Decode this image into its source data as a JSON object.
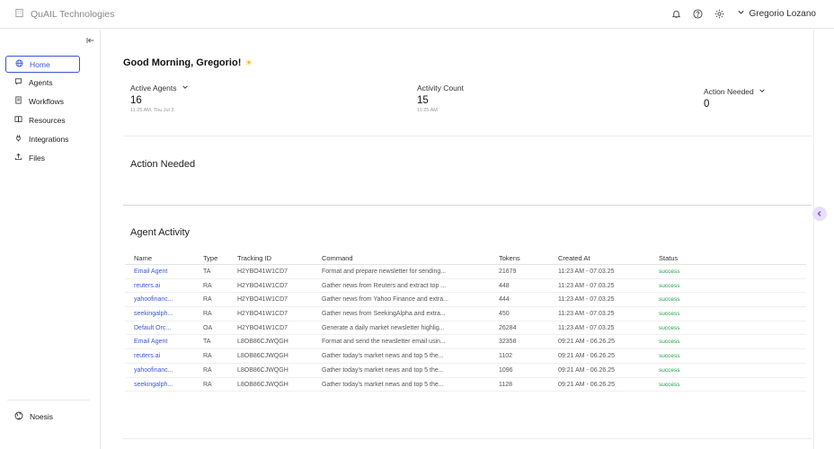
{
  "app": {
    "brand": "QuAIL Technologies"
  },
  "header": {
    "user_name": "Gregorio Lozano"
  },
  "sidebar": {
    "items": [
      {
        "label": "Home",
        "icon": "globe-icon",
        "active": true
      },
      {
        "label": "Agents",
        "icon": "chat-icon"
      },
      {
        "label": "Workflows",
        "icon": "document-icon"
      },
      {
        "label": "Resources",
        "icon": "book-icon"
      },
      {
        "label": "Integrations",
        "icon": "plug-icon"
      },
      {
        "label": "Files",
        "icon": "upload-icon"
      }
    ],
    "footer_label": "Noesis"
  },
  "main": {
    "greeting": "Good Morning, Gregorio!",
    "stats": [
      {
        "label": "Active Agents",
        "value": "16",
        "sub": "11:25 AM, Thu Jul 3"
      },
      {
        "label": "Activity Count",
        "value": "15",
        "sub": "11:25 AM"
      },
      {
        "label": "Action Needed",
        "value": "0",
        "sub": ""
      }
    ],
    "action_needed_title": "Action Needed",
    "activity_title": "Agent Activity"
  },
  "table": {
    "columns": [
      "Name",
      "Type",
      "Tracking ID",
      "Command",
      "Tokens",
      "Created At",
      "Status"
    ],
    "rows": [
      {
        "name": "Email Agent",
        "type": "TA",
        "tracking_id": "H2YBO41W1CD7",
        "command": "Format and prepare newsletter for sending...",
        "tokens": "21679",
        "created": "11:23 AM - 07.03.25",
        "status": "success"
      },
      {
        "name": "reuters.ai",
        "type": "RA",
        "tracking_id": "H2YBO41W1CD7",
        "command": "Gather news from Reuters and extract top ...",
        "tokens": "448",
        "created": "11:23 AM - 07.03.25",
        "status": "success"
      },
      {
        "name": "yahoofinanc...",
        "type": "RA",
        "tracking_id": "H2YBO41W1CD7",
        "command": "Gather news from Yahoo Finance and extra...",
        "tokens": "444",
        "created": "11:23 AM - 07.03.25",
        "status": "success"
      },
      {
        "name": "seekingalph...",
        "type": "RA",
        "tracking_id": "H2YBO41W1CD7",
        "command": "Gather news from SeekingAlpha and extra...",
        "tokens": "450",
        "created": "11:23 AM - 07.03.25",
        "status": "success"
      },
      {
        "name": "Default Orc...",
        "type": "OA",
        "tracking_id": "H2YBO41W1CD7",
        "command": "Generate a daily market newsletter highlig...",
        "tokens": "26284",
        "created": "11:23 AM - 07.03.25",
        "status": "success"
      },
      {
        "name": "Email Agent",
        "type": "TA",
        "tracking_id": "L8OB86CJWQGH",
        "command": "Format and send the newsletter email usin...",
        "tokens": "32358",
        "created": "09:21 AM - 06.26.25",
        "status": "success"
      },
      {
        "name": "reuters.ai",
        "type": "RA",
        "tracking_id": "L8OB86CJWQGH",
        "command": "Gather today's market news and top 5 the...",
        "tokens": "1102",
        "created": "09:21 AM - 06.26.25",
        "status": "success"
      },
      {
        "name": "yahoofinanc...",
        "type": "RA",
        "tracking_id": "L8OB86CJWQGH",
        "command": "Gather today's market news and top 5 the...",
        "tokens": "1096",
        "created": "09:21 AM - 06.26.25",
        "status": "success"
      },
      {
        "name": "seekingalph...",
        "type": "RA",
        "tracking_id": "L8OB86CJWQGH",
        "command": "Gather today's market news and top 5 the...",
        "tokens": "1128",
        "created": "09:21 AM - 06.26.25",
        "status": "success"
      }
    ]
  },
  "colors": {
    "accent": "#3a56d4",
    "success": "#22a34a",
    "sun": "#f4b400",
    "toggle_bg": "#e9defc"
  }
}
